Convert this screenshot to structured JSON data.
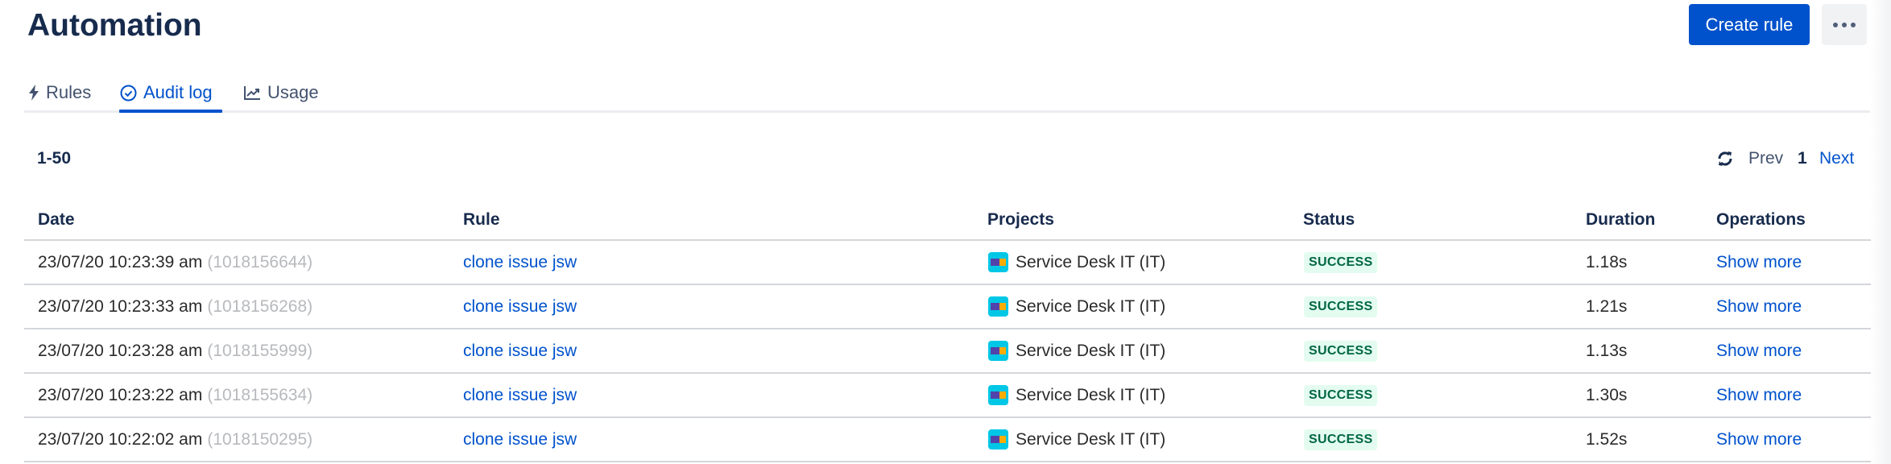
{
  "header": {
    "title": "Automation",
    "create_label": "Create rule",
    "more_label": "More actions"
  },
  "tabs": [
    {
      "label": "Rules",
      "icon": "lightning-icon"
    },
    {
      "label": "Audit log",
      "icon": "check-circle-icon",
      "active": true
    },
    {
      "label": "Usage",
      "icon": "chart-icon"
    }
  ],
  "pagination": {
    "range": "1-50",
    "prev": "Prev",
    "page": "1",
    "next": "Next"
  },
  "table": {
    "columns": [
      "Date",
      "Rule",
      "Projects",
      "Status",
      "Duration",
      "Operations"
    ],
    "rows": [
      {
        "date": "23/07/20 10:23:39 am",
        "id": "(1018156644)",
        "rule": "clone issue jsw",
        "project": "Service Desk IT (IT)",
        "status": "SUCCESS",
        "duration": "1.18s",
        "op": "Show more"
      },
      {
        "date": "23/07/20 10:23:33 am",
        "id": "(1018156268)",
        "rule": "clone issue jsw",
        "project": "Service Desk IT (IT)",
        "status": "SUCCESS",
        "duration": "1.21s",
        "op": "Show more"
      },
      {
        "date": "23/07/20 10:23:28 am",
        "id": "(1018155999)",
        "rule": "clone issue jsw",
        "project": "Service Desk IT (IT)",
        "status": "SUCCESS",
        "duration": "1.13s",
        "op": "Show more"
      },
      {
        "date": "23/07/20 10:23:22 am",
        "id": "(1018155634)",
        "rule": "clone issue jsw",
        "project": "Service Desk IT (IT)",
        "status": "SUCCESS",
        "duration": "1.30s",
        "op": "Show more"
      },
      {
        "date": "23/07/20 10:22:02 am",
        "id": "(1018150295)",
        "rule": "clone issue jsw",
        "project": "Service Desk IT (IT)",
        "status": "SUCCESS",
        "duration": "1.52s",
        "op": "Show more"
      }
    ]
  },
  "colors": {
    "primary": "#0052cc",
    "success_bg": "#e3fcef",
    "success_text": "#006644",
    "text": "#172b4d"
  }
}
